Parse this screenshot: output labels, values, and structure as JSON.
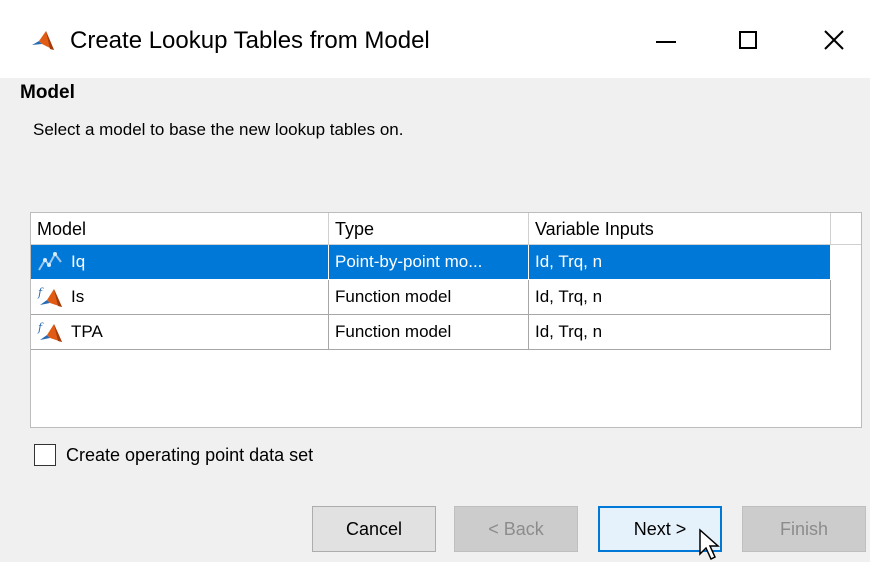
{
  "window": {
    "title": "Create Lookup Tables from Model",
    "controls": [
      "minimize-icon",
      "maximize-icon",
      "close-icon"
    ]
  },
  "page": {
    "heading": "Model",
    "description": "Select a model to base the new lookup tables on."
  },
  "table": {
    "columns": [
      "Model",
      "Type",
      "Variable Inputs"
    ],
    "rows": [
      {
        "name": "Iq",
        "type": "Point-by-point mo...",
        "inputs": "Id, Trq, n",
        "icon": "point-by-point-model-icon",
        "selected": true
      },
      {
        "name": "Is",
        "type": "Function model",
        "inputs": "Id, Trq, n",
        "icon": "matlab-function-icon",
        "selected": false
      },
      {
        "name": "TPA",
        "type": "Function model",
        "inputs": "Id, Trq, n",
        "icon": "matlab-function-icon",
        "selected": false
      }
    ]
  },
  "options": {
    "create_opdata_label": "Create operating point data set",
    "create_opdata_checked": false
  },
  "buttons": {
    "cancel": "Cancel",
    "back": "< Back",
    "next": "Next >",
    "finish": "Finish"
  },
  "colors": {
    "selection": "#0078d7",
    "dialog_bg": "#f0f0f0",
    "disabled_text": "#8c8c8c"
  }
}
